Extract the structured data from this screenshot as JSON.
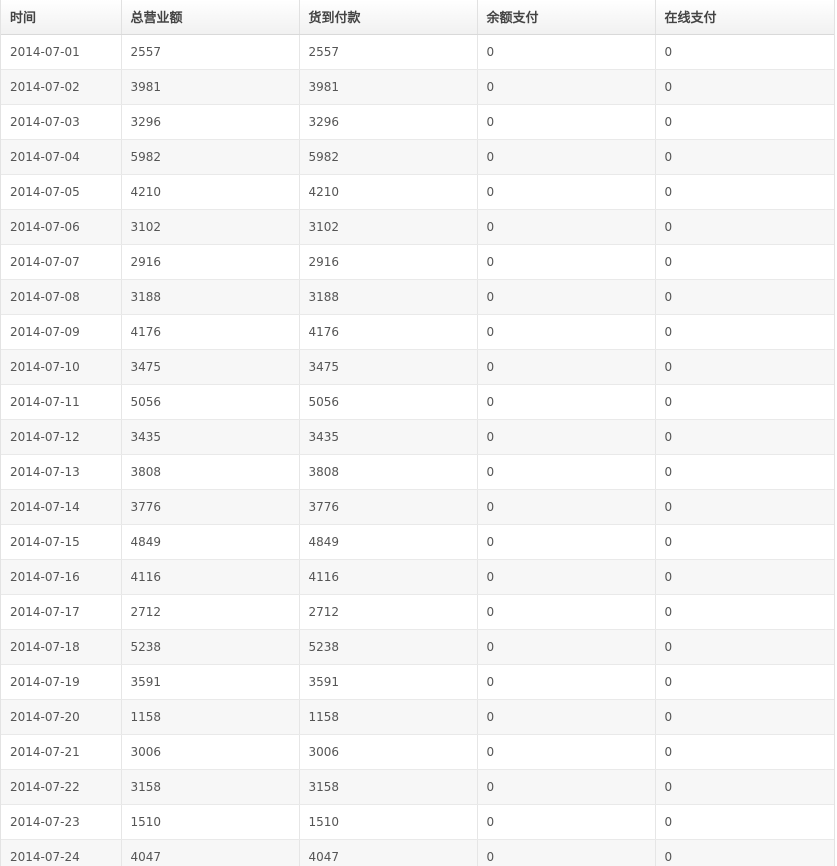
{
  "table": {
    "headers": [
      "时间",
      "总营业额",
      "货到付款",
      "余额支付",
      "在线支付"
    ],
    "rows": [
      [
        "2014-07-01",
        "2557",
        "2557",
        "0",
        "0"
      ],
      [
        "2014-07-02",
        "3981",
        "3981",
        "0",
        "0"
      ],
      [
        "2014-07-03",
        "3296",
        "3296",
        "0",
        "0"
      ],
      [
        "2014-07-04",
        "5982",
        "5982",
        "0",
        "0"
      ],
      [
        "2014-07-05",
        "4210",
        "4210",
        "0",
        "0"
      ],
      [
        "2014-07-06",
        "3102",
        "3102",
        "0",
        "0"
      ],
      [
        "2014-07-07",
        "2916",
        "2916",
        "0",
        "0"
      ],
      [
        "2014-07-08",
        "3188",
        "3188",
        "0",
        "0"
      ],
      [
        "2014-07-09",
        "4176",
        "4176",
        "0",
        "0"
      ],
      [
        "2014-07-10",
        "3475",
        "3475",
        "0",
        "0"
      ],
      [
        "2014-07-11",
        "5056",
        "5056",
        "0",
        "0"
      ],
      [
        "2014-07-12",
        "3435",
        "3435",
        "0",
        "0"
      ],
      [
        "2014-07-13",
        "3808",
        "3808",
        "0",
        "0"
      ],
      [
        "2014-07-14",
        "3776",
        "3776",
        "0",
        "0"
      ],
      [
        "2014-07-15",
        "4849",
        "4849",
        "0",
        "0"
      ],
      [
        "2014-07-16",
        "4116",
        "4116",
        "0",
        "0"
      ],
      [
        "2014-07-17",
        "2712",
        "2712",
        "0",
        "0"
      ],
      [
        "2014-07-18",
        "5238",
        "5238",
        "0",
        "0"
      ],
      [
        "2014-07-19",
        "3591",
        "3591",
        "0",
        "0"
      ],
      [
        "2014-07-20",
        "1158",
        "1158",
        "0",
        "0"
      ],
      [
        "2014-07-21",
        "3006",
        "3006",
        "0",
        "0"
      ],
      [
        "2014-07-22",
        "3158",
        "3158",
        "0",
        "0"
      ],
      [
        "2014-07-23",
        "1510",
        "1510",
        "0",
        "0"
      ],
      [
        "2014-07-24",
        "4047",
        "4047",
        "0",
        "0"
      ]
    ]
  }
}
